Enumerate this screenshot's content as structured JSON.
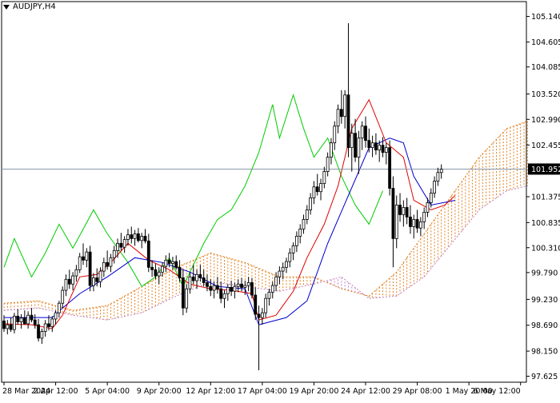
{
  "chart_title": "AUDJPY,H4",
  "current_price_label": "101.952",
  "colors": {
    "background": "#ffffff",
    "frame": "#000000",
    "bull_candle": "#ffffff",
    "bear_candle": "#000000",
    "tenkan": "#e00000",
    "kijun": "#0000d0",
    "chikou": "#00cc00",
    "kumo_up": "#e08020",
    "kumo_down": "#c080c0",
    "price_line": "#8899aa"
  },
  "chart_data": {
    "type": "candlestick",
    "indicator": "ichimoku",
    "ylim": [
      97.5,
      105.45
    ],
    "y_ticks": [
      "105.140",
      "104.605",
      "104.085",
      "103.520",
      "102.990",
      "102.455",
      "101.952",
      "101.375",
      "100.835",
      "100.310",
      "99.790",
      "99.230",
      "98.690",
      "98.150",
      "97.625"
    ],
    "y_tick_values": [
      105.14,
      104.605,
      104.085,
      103.52,
      102.99,
      102.455,
      101.952,
      101.375,
      100.835,
      100.31,
      99.79,
      99.23,
      98.69,
      98.15,
      97.625
    ],
    "x_labels": [
      "28 Mar 2024",
      "2 Apr 12:00",
      "5 Apr 04:00",
      "9 Apr 20:00",
      "12 Apr 12:00",
      "17 Apr 04:00",
      "19 Apr 20:00",
      "24 Apr 12:00",
      "29 Apr 08:00",
      "1 May 20:00",
      "6 May 12:00"
    ],
    "x_label_bars": [
      0,
      15,
      30,
      45,
      60,
      75,
      90,
      105,
      120,
      135,
      150
    ],
    "total_bars": 152,
    "last_price": 101.952,
    "ohlc": [
      [
        98.78,
        98.9,
        98.55,
        98.62
      ],
      [
        98.62,
        98.8,
        98.5,
        98.7
      ],
      [
        98.7,
        98.85,
        98.55,
        98.6
      ],
      [
        98.6,
        98.95,
        98.52,
        98.88
      ],
      [
        98.88,
        99.02,
        98.7,
        98.76
      ],
      [
        98.76,
        98.92,
        98.62,
        98.84
      ],
      [
        98.84,
        99.0,
        98.7,
        98.72
      ],
      [
        98.72,
        98.98,
        98.62,
        98.9
      ],
      [
        98.9,
        99.05,
        98.75,
        98.8
      ],
      [
        98.8,
        98.92,
        98.62,
        98.7
      ],
      [
        98.7,
        98.82,
        98.35,
        98.42
      ],
      [
        98.42,
        98.62,
        98.3,
        98.56
      ],
      [
        98.56,
        98.8,
        98.45,
        98.72
      ],
      [
        98.72,
        98.9,
        98.58,
        98.66
      ],
      [
        98.66,
        98.88,
        98.55,
        98.82
      ],
      [
        98.82,
        99.0,
        98.7,
        98.95
      ],
      [
        98.95,
        99.2,
        98.85,
        99.15
      ],
      [
        99.15,
        99.5,
        99.05,
        99.42
      ],
      [
        99.42,
        99.75,
        99.3,
        99.65
      ],
      [
        99.65,
        99.85,
        99.45,
        99.55
      ],
      [
        99.55,
        99.8,
        99.42,
        99.72
      ],
      [
        99.72,
        99.95,
        99.6,
        99.85
      ],
      [
        99.85,
        100.2,
        99.78,
        100.12
      ],
      [
        100.12,
        100.4,
        99.95,
        100.05
      ],
      [
        100.05,
        100.3,
        99.9,
        100.22
      ],
      [
        100.22,
        100.35,
        99.4,
        99.52
      ],
      [
        99.52,
        99.78,
        99.4,
        99.68
      ],
      [
        99.68,
        99.88,
        99.5,
        99.6
      ],
      [
        99.6,
        99.9,
        99.48,
        99.82
      ],
      [
        99.82,
        100.1,
        99.7,
        100.0
      ],
      [
        100.0,
        100.25,
        99.85,
        99.92
      ],
      [
        99.92,
        100.18,
        99.8,
        100.1
      ],
      [
        100.1,
        100.35,
        99.98,
        100.25
      ],
      [
        100.25,
        100.5,
        100.1,
        100.4
      ],
      [
        100.4,
        100.62,
        100.25,
        100.32
      ],
      [
        100.32,
        100.55,
        100.2,
        100.48
      ],
      [
        100.48,
        100.7,
        100.35,
        100.58
      ],
      [
        100.58,
        100.75,
        100.4,
        100.5
      ],
      [
        100.5,
        100.68,
        100.35,
        100.6
      ],
      [
        100.6,
        100.72,
        100.42,
        100.46
      ],
      [
        100.46,
        100.62,
        100.3,
        100.55
      ],
      [
        100.55,
        100.7,
        100.4,
        100.45
      ],
      [
        100.45,
        100.6,
        99.8,
        99.9
      ],
      [
        99.9,
        100.05,
        99.7,
        99.85
      ],
      [
        99.85,
        99.98,
        99.65,
        99.72
      ],
      [
        99.72,
        99.9,
        99.55,
        99.8
      ],
      [
        99.8,
        100.0,
        99.7,
        99.92
      ],
      [
        99.92,
        100.15,
        99.8,
        100.05
      ],
      [
        100.05,
        100.2,
        99.9,
        99.98
      ],
      [
        99.98,
        100.12,
        99.85,
        100.02
      ],
      [
        100.02,
        100.15,
        99.85,
        99.9
      ],
      [
        99.9,
        100.05,
        99.6,
        99.68
      ],
      [
        99.68,
        99.85,
        98.9,
        99.05
      ],
      [
        99.05,
        99.55,
        98.95,
        99.45
      ],
      [
        99.45,
        99.8,
        99.35,
        99.7
      ],
      [
        99.7,
        99.95,
        99.55,
        99.62
      ],
      [
        99.62,
        99.85,
        99.45,
        99.75
      ],
      [
        99.75,
        99.95,
        99.6,
        99.68
      ],
      [
        99.68,
        99.85,
        99.5,
        99.58
      ],
      [
        99.58,
        99.75,
        99.4,
        99.5
      ],
      [
        99.5,
        99.65,
        99.3,
        99.42
      ],
      [
        99.42,
        99.6,
        99.25,
        99.52
      ],
      [
        99.52,
        99.7,
        99.35,
        99.45
      ],
      [
        99.45,
        99.6,
        99.15,
        99.25
      ],
      [
        99.25,
        99.42,
        99.05,
        99.35
      ],
      [
        99.35,
        99.55,
        99.2,
        99.48
      ],
      [
        99.48,
        99.62,
        99.3,
        99.4
      ],
      [
        99.4,
        99.58,
        99.25,
        99.5
      ],
      [
        99.5,
        99.65,
        99.38,
        99.55
      ],
      [
        99.55,
        99.68,
        99.4,
        99.48
      ],
      [
        99.48,
        99.62,
        99.32,
        99.52
      ],
      [
        99.52,
        99.7,
        99.4,
        99.58
      ],
      [
        99.58,
        99.68,
        99.25,
        99.32
      ],
      [
        99.32,
        99.48,
        98.8,
        98.92
      ],
      [
        98.92,
        99.1,
        97.75,
        98.85
      ],
      [
        98.85,
        99.05,
        98.7,
        98.95
      ],
      [
        98.95,
        99.35,
        98.85,
        99.25
      ],
      [
        99.25,
        99.45,
        99.1,
        99.38
      ],
      [
        99.38,
        99.6,
        99.25,
        99.52
      ],
      [
        99.52,
        99.8,
        99.4,
        99.7
      ],
      [
        99.7,
        99.92,
        99.55,
        99.82
      ],
      [
        99.82,
        100.0,
        99.65,
        99.9
      ],
      [
        99.9,
        100.1,
        99.78,
        100.02
      ],
      [
        100.02,
        100.3,
        99.9,
        100.2
      ],
      [
        100.2,
        100.42,
        100.05,
        100.35
      ],
      [
        100.35,
        100.65,
        100.22,
        100.55
      ],
      [
        100.55,
        100.8,
        100.4,
        100.7
      ],
      [
        100.7,
        101.0,
        100.6,
        100.9
      ],
      [
        100.9,
        101.2,
        100.8,
        101.1
      ],
      [
        101.1,
        101.45,
        101.0,
        101.35
      ],
      [
        101.35,
        101.7,
        101.22,
        101.58
      ],
      [
        101.58,
        101.85,
        101.4,
        101.48
      ],
      [
        101.48,
        101.75,
        101.3,
        101.65
      ],
      [
        101.65,
        102.0,
        101.55,
        101.9
      ],
      [
        101.9,
        102.3,
        101.8,
        102.2
      ],
      [
        102.2,
        102.6,
        102.05,
        102.5
      ],
      [
        102.5,
        102.95,
        102.35,
        102.85
      ],
      [
        102.85,
        103.3,
        102.7,
        103.2
      ],
      [
        103.2,
        103.6,
        102.9,
        103.05
      ],
      [
        103.05,
        103.6,
        102.8,
        103.5
      ],
      [
        103.5,
        105.0,
        102.2,
        102.4
      ],
      [
        102.4,
        102.9,
        101.9,
        102.7
      ],
      [
        102.7,
        103.0,
        102.1,
        102.2
      ],
      [
        102.2,
        102.75,
        101.85,
        102.6
      ],
      [
        102.6,
        102.95,
        102.35,
        102.85
      ],
      [
        102.85,
        103.05,
        102.4,
        102.55
      ],
      [
        102.55,
        102.8,
        102.3,
        102.4
      ],
      [
        102.4,
        102.65,
        102.2,
        102.5
      ],
      [
        102.5,
        102.7,
        102.25,
        102.35
      ],
      [
        102.35,
        102.55,
        102.1,
        102.45
      ],
      [
        102.45,
        102.62,
        102.2,
        102.3
      ],
      [
        102.3,
        102.5,
        102.05,
        102.4
      ],
      [
        102.4,
        102.55,
        101.4,
        101.55
      ],
      [
        101.55,
        101.8,
        99.9,
        100.5
      ],
      [
        100.5,
        101.4,
        100.3,
        101.2
      ],
      [
        101.2,
        101.45,
        100.85,
        101.0
      ],
      [
        101.0,
        101.3,
        100.75,
        101.15
      ],
      [
        101.15,
        101.35,
        100.8,
        100.95
      ],
      [
        100.95,
        101.2,
        100.6,
        100.75
      ],
      [
        100.75,
        101.0,
        100.5,
        100.9
      ],
      [
        100.9,
        101.1,
        100.62,
        100.72
      ],
      [
        100.72,
        100.95,
        100.55,
        100.85
      ],
      [
        100.85,
        101.15,
        100.7,
        101.05
      ],
      [
        101.05,
        101.35,
        100.95,
        101.25
      ],
      [
        101.25,
        101.55,
        101.15,
        101.45
      ],
      [
        101.45,
        101.8,
        101.35,
        101.7
      ],
      [
        101.7,
        101.98,
        101.6,
        101.88
      ],
      [
        101.88,
        102.05,
        101.75,
        101.95
      ]
    ],
    "tenkan": [
      [
        0,
        98.72
      ],
      [
        8,
        98.7
      ],
      [
        14,
        98.62
      ],
      [
        17,
        98.9
      ],
      [
        22,
        99.7
      ],
      [
        27,
        99.75
      ],
      [
        31,
        100.0
      ],
      [
        36,
        100.4
      ],
      [
        42,
        100.05
      ],
      [
        48,
        99.85
      ],
      [
        54,
        99.55
      ],
      [
        60,
        99.45
      ],
      [
        66,
        99.42
      ],
      [
        72,
        99.35
      ],
      [
        74,
        98.8
      ],
      [
        79,
        98.9
      ],
      [
        84,
        99.4
      ],
      [
        88,
        100.1
      ],
      [
        93,
        100.8
      ],
      [
        97,
        101.6
      ],
      [
        101,
        102.8
      ],
      [
        106,
        103.4
      ],
      [
        111,
        102.5
      ],
      [
        116,
        102.2
      ],
      [
        119,
        101.3
      ],
      [
        124,
        101.1
      ],
      [
        128,
        101.2
      ],
      [
        131,
        101.4
      ]
    ],
    "kijun": [
      [
        0,
        98.85
      ],
      [
        14,
        98.85
      ],
      [
        17,
        99.05
      ],
      [
        22,
        99.35
      ],
      [
        30,
        99.7
      ],
      [
        38,
        100.1
      ],
      [
        46,
        100.0
      ],
      [
        54,
        99.8
      ],
      [
        62,
        99.5
      ],
      [
        70,
        99.45
      ],
      [
        74,
        98.7
      ],
      [
        82,
        98.85
      ],
      [
        88,
        99.2
      ],
      [
        94,
        100.4
      ],
      [
        100,
        101.4
      ],
      [
        106,
        102.4
      ],
      [
        112,
        102.6
      ],
      [
        116,
        102.5
      ],
      [
        119,
        101.8
      ],
      [
        124,
        101.2
      ],
      [
        131,
        101.3
      ]
    ],
    "chikou": [
      [
        0,
        99.9
      ],
      [
        3,
        100.5
      ],
      [
        8,
        99.7
      ],
      [
        12,
        100.2
      ],
      [
        16,
        100.8
      ],
      [
        20,
        100.3
      ],
      [
        26,
        101.1
      ],
      [
        30,
        100.6
      ],
      [
        36,
        100.0
      ],
      [
        40,
        99.5
      ],
      [
        44,
        99.7
      ],
      [
        48,
        100.1
      ],
      [
        52,
        99.5
      ],
      [
        58,
        100.4
      ],
      [
        62,
        100.9
      ],
      [
        66,
        101.1
      ],
      [
        70,
        101.6
      ],
      [
        74,
        102.3
      ],
      [
        78,
        103.3
      ],
      [
        80,
        102.6
      ],
      [
        84,
        103.5
      ],
      [
        87,
        102.8
      ],
      [
        90,
        102.2
      ],
      [
        94,
        102.6
      ],
      [
        98,
        101.8
      ],
      [
        102,
        101.2
      ],
      [
        106,
        100.8
      ],
      [
        110,
        101.5
      ]
    ],
    "span_a": [
      [
        0,
        99.15
      ],
      [
        10,
        99.2
      ],
      [
        20,
        99.0
      ],
      [
        30,
        99.1
      ],
      [
        40,
        99.5
      ],
      [
        50,
        99.9
      ],
      [
        60,
        100.2
      ],
      [
        70,
        100.0
      ],
      [
        80,
        99.7
      ],
      [
        90,
        99.7
      ],
      [
        98,
        99.45
      ],
      [
        106,
        99.3
      ],
      [
        114,
        99.8
      ],
      [
        122,
        100.6
      ],
      [
        130,
        101.4
      ],
      [
        138,
        102.2
      ],
      [
        146,
        102.8
      ],
      [
        152,
        102.95
      ]
    ],
    "span_b": [
      [
        0,
        99.0
      ],
      [
        10,
        99.05
      ],
      [
        20,
        98.9
      ],
      [
        30,
        98.8
      ],
      [
        40,
        98.95
      ],
      [
        50,
        99.3
      ],
      [
        60,
        99.6
      ],
      [
        70,
        99.5
      ],
      [
        80,
        99.4
      ],
      [
        90,
        99.55
      ],
      [
        98,
        99.7
      ],
      [
        106,
        99.25
      ],
      [
        114,
        99.3
      ],
      [
        122,
        99.7
      ],
      [
        130,
        100.4
      ],
      [
        138,
        101.1
      ],
      [
        146,
        101.5
      ],
      [
        152,
        101.6
      ]
    ]
  }
}
